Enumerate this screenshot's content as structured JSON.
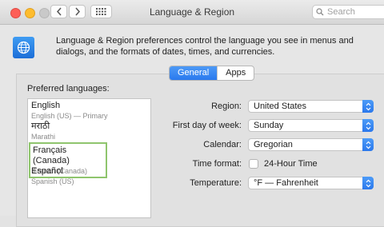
{
  "window": {
    "title": "Language & Region"
  },
  "toolbar": {
    "search_placeholder": "Search"
  },
  "header": {
    "description": "Language & Region preferences control the language you see in menus and dialogs, and the formats of dates, times, and currencies."
  },
  "tabs": [
    {
      "label": "General",
      "selected": true
    },
    {
      "label": "Apps",
      "selected": false
    }
  ],
  "preferred_languages": {
    "label": "Preferred languages:",
    "items": [
      {
        "name": "English",
        "sub": "English (US) — Primary"
      },
      {
        "name": "मराठी",
        "sub": "Marathi"
      },
      {
        "name": "Français (Canada)",
        "sub": "French (Canada)"
      },
      {
        "name": "Español",
        "sub": "Spanish (US)"
      }
    ]
  },
  "settings": {
    "region": {
      "label": "Region:",
      "value": "United States"
    },
    "first_day": {
      "label": "First day of week:",
      "value": "Sunday"
    },
    "calendar": {
      "label": "Calendar:",
      "value": "Gregorian"
    },
    "time_format": {
      "label": "Time format:",
      "checkbox_label": "24-Hour Time",
      "checked": false
    },
    "temperature": {
      "label": "Temperature:",
      "value": "°F — Fahrenheit"
    }
  },
  "colors": {
    "accent": "#2b78ec",
    "highlight_border": "#8fc56d"
  }
}
